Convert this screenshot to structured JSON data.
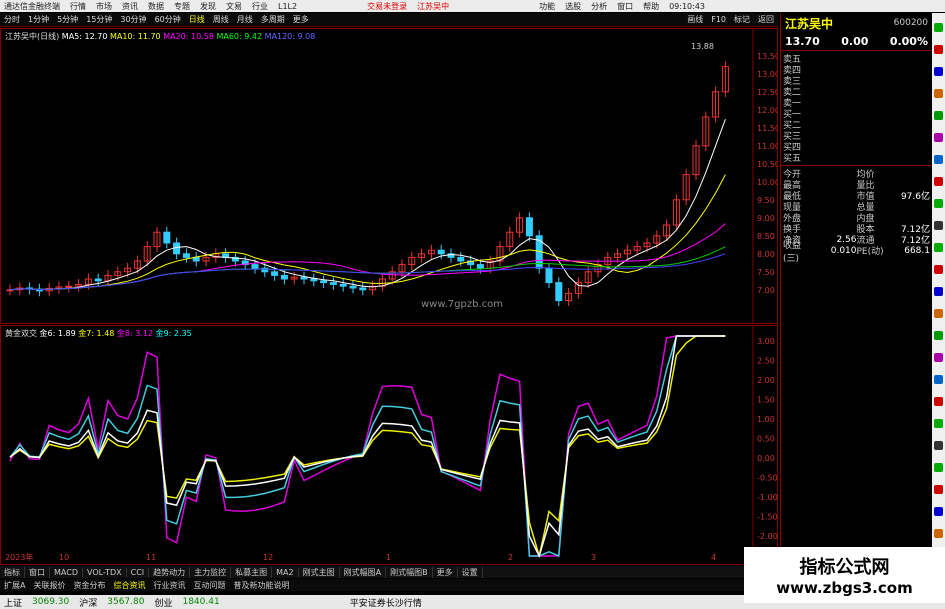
{
  "titlebar": {
    "app": "通达信金融终端",
    "menus": [
      "行情",
      "市场",
      "资讯",
      "数据",
      "专题",
      "发现",
      "文易",
      "行业",
      "L1L2"
    ],
    "trade": "交易未登录",
    "stock_title": "江苏吴中",
    "right_menus": [
      "功能",
      "选股",
      "分析",
      "窗口",
      "帮助"
    ],
    "time": "09:10:43"
  },
  "toolbar": {
    "items": [
      "分时",
      "1分钟",
      "5分钟",
      "15分钟",
      "30分钟",
      "60分钟",
      "日线",
      "周线",
      "月线",
      "多周期",
      "更多"
    ],
    "active": "日线",
    "right": [
      "画线",
      "F10",
      "标记",
      "返回"
    ]
  },
  "main_legend": {
    "name": "江苏吴中(日线)",
    "ma5": "MA5: 12.70",
    "ma10": "MA10: 11.70",
    "ma20": "MA20: 10.58",
    "ma60": "MA60: 9.42",
    "ma120": "MA120: 9.08"
  },
  "main_chart": {
    "high_label": "13.88",
    "axis": [
      "13.50",
      "13.00",
      "12.50",
      "12.00",
      "11.50",
      "11.00",
      "10.50",
      "10.00",
      "9.50",
      "9.00",
      "8.50",
      "8.00",
      "7.50",
      "7.00"
    ],
    "watermark": "www.7gpzb.com"
  },
  "ind_legend": {
    "name": "黄金双交",
    "g6": "金6: 1.89",
    "g7": "金7: 1.48",
    "g8": "金8: 3.12",
    "g9": "金9: 2.35"
  },
  "ind_axis": [
    "3.00",
    "2.50",
    "2.00",
    "1.50",
    "1.00",
    "0.50",
    "0.00",
    "-0.50",
    "-1.00",
    "-1.50",
    "-2.00"
  ],
  "x_axis": [
    "2023年",
    "10",
    "11",
    "12",
    "1",
    "2",
    "3",
    "4"
  ],
  "bottom_tabs": [
    "指标",
    "窗口",
    "MACD",
    "VOL-TDX",
    "CCI",
    "趋势动力",
    "主力监控",
    "私募主图",
    "MA2",
    "刚式主图",
    "刚式幅图A",
    "刚式幅图B",
    "更多",
    "设置"
  ],
  "bottom_tabs2": [
    "扩展A",
    "关联报价",
    "资金分布",
    "综合资讯",
    "行业资讯",
    "互动问题",
    "普及新功能说明"
  ],
  "side": {
    "name": "江苏吴中",
    "code": "600200",
    "price": "13.70",
    "chg": "0.00",
    "pct": "0.00%",
    "book": [
      "卖五",
      "卖四",
      "卖三",
      "卖二",
      "卖一",
      "买一",
      "买二",
      "买三",
      "买四",
      "买五"
    ],
    "stats": [
      {
        "k": "今开",
        "v": "",
        "k2": "均价",
        "v2": ""
      },
      {
        "k": "最高",
        "v": "",
        "k2": "量比",
        "v2": ""
      },
      {
        "k": "最低",
        "v": "",
        "k2": "市值",
        "v2": "97.6亿"
      },
      {
        "k": "现量",
        "v": "",
        "k2": "总量",
        "v2": ""
      },
      {
        "k": "外盘",
        "v": "",
        "k2": "内盘",
        "v2": ""
      },
      {
        "k": "换手",
        "v": "",
        "k2": "股本",
        "v2": "7.12亿"
      },
      {
        "k": "净资",
        "v": "2.56",
        "k2": "流通",
        "v2": "7.12亿"
      },
      {
        "k": "收益(三)",
        "v": "0.010",
        "k2": "PE(动)",
        "v2": "668.1"
      }
    ]
  },
  "statusbar": {
    "sh": "上证",
    "sh_val": "3069.30",
    "sz": "沪深",
    "sz_val": "3567.80",
    "cy": "创业",
    "cy_val": "1840.41",
    "broker": "平安证券长沙行情"
  },
  "watermark": {
    "line1": "指标公式网",
    "line2": "www.zbgs3.com"
  }
}
